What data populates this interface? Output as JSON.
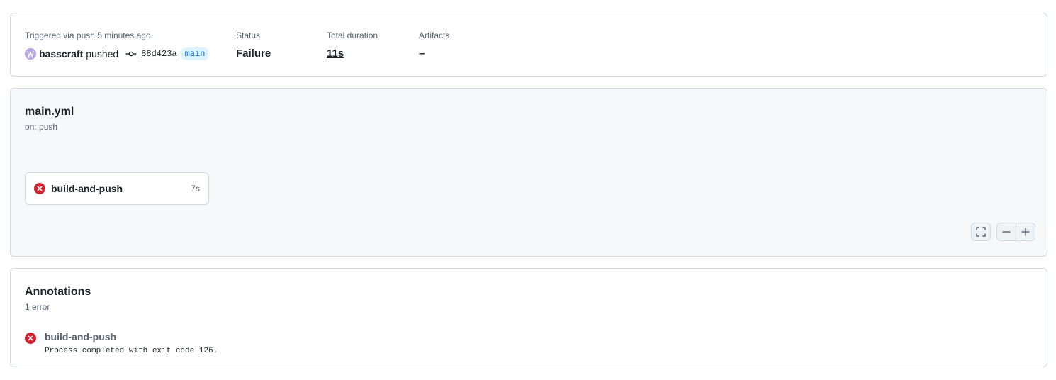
{
  "summary": {
    "trigger_label": "Triggered via push 5 minutes ago",
    "actor": "basscraft",
    "action": "pushed",
    "commit_sha": "88d423a",
    "branch": "main",
    "status_label": "Status",
    "status_value": "Failure",
    "duration_label": "Total duration",
    "duration_value": "11s",
    "artifacts_label": "Artifacts",
    "artifacts_value": "–"
  },
  "workflow": {
    "file": "main.yml",
    "trigger": "on: push",
    "jobs": [
      {
        "name": "build-and-push",
        "duration": "7s",
        "status": "failure",
        "status_icon": "x-circle-icon"
      }
    ],
    "controls": {
      "fullscreen_icon": "fullscreen-icon",
      "zoom_out_icon": "zoom-out-icon",
      "zoom_in_icon": "zoom-in-icon"
    }
  },
  "annotations": {
    "title": "Annotations",
    "count": "1 error",
    "items": [
      {
        "job": "build-and-push",
        "message": "Process completed with exit code 126.",
        "level_icon": "x-circle-icon"
      }
    ]
  },
  "colors": {
    "failure": "#cf222e",
    "branch_text": "#0969da",
    "branch_bg": "#ddf4ff",
    "muted_text": "#59636e",
    "border": "#d1d9e0",
    "graph_bg": "#f6f8fa"
  }
}
